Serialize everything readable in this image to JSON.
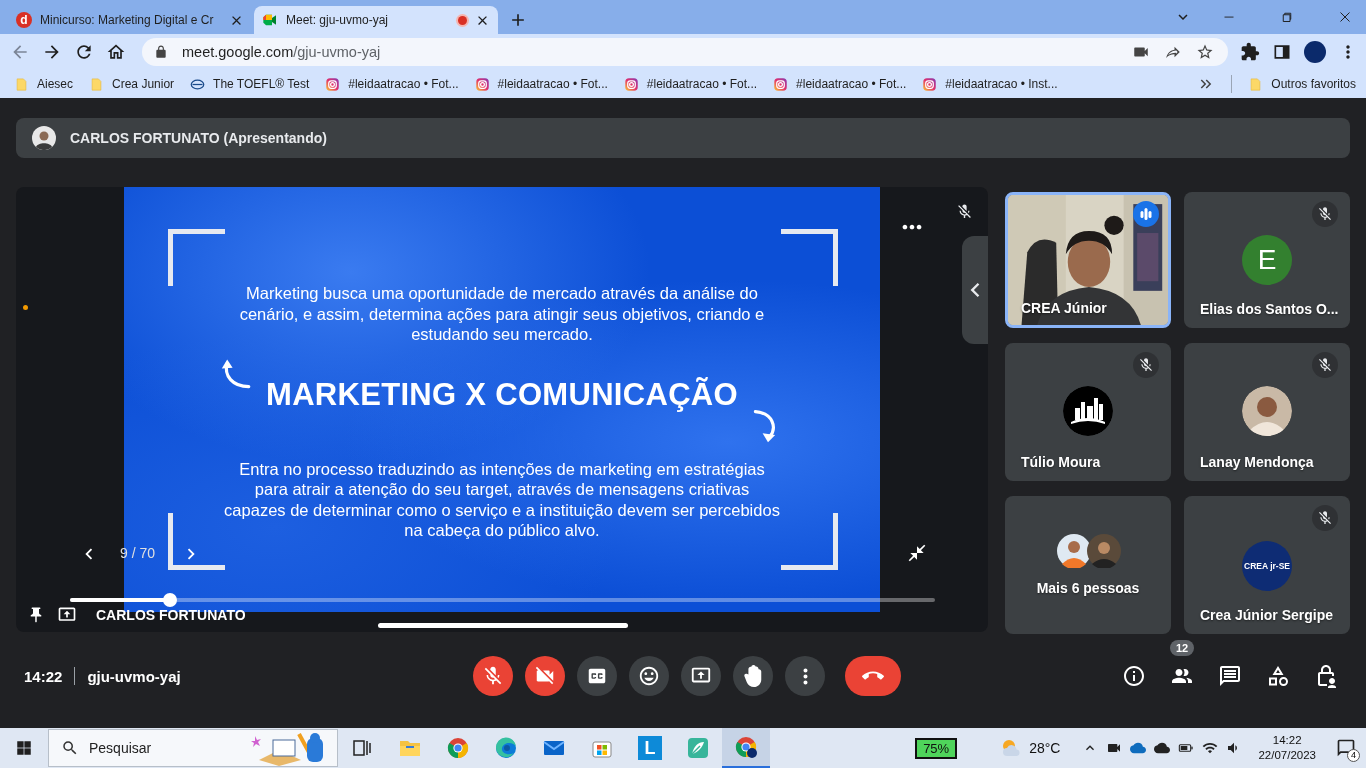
{
  "browser": {
    "tabs": [
      {
        "title": "Minicurso: Marketing Digital e Cr",
        "favicon_letter": "d",
        "recording": false,
        "selected": false
      },
      {
        "title": "Meet: gju-uvmo-yaj",
        "recording": true,
        "selected": true
      }
    ],
    "address": {
      "host": "meet.google.com",
      "path": "/gju-uvmo-yaj"
    },
    "bookmarks": [
      {
        "kind": "folder",
        "label": "Aiesec"
      },
      {
        "kind": "folder",
        "label": "Crea Junior"
      },
      {
        "kind": "ets",
        "label": "The TOEFL® Test"
      },
      {
        "kind": "instagram",
        "label": "#leidaatracao • Fot..."
      },
      {
        "kind": "instagram",
        "label": "#leidaatracao • Fot..."
      },
      {
        "kind": "instagram",
        "label": "#leidaatracao • Fot..."
      },
      {
        "kind": "instagram",
        "label": "#leidaatracao • Fot..."
      },
      {
        "kind": "instagram",
        "label": "#leidaatracao • Inst..."
      }
    ],
    "other_bookmarks": "Outros favoritos"
  },
  "meet": {
    "presenter_bar": "CARLOS FORTUNATO (Apresentando)",
    "slide": {
      "paragraph_1": "Marketing busca uma oportunidade de mercado através da análise do cenário, e assim, determina ações para atingir seus objetivos, criando e estudando seu mercado.",
      "title": "MARKETING X COMUNICAÇÃO",
      "paragraph_2": "Entra no processo traduzindo as intenções de marketing em estratégias para atrair a atenção do seu target, através de mensagens criativas capazes de determinar como o serviço e a instituição devem ser percebidos na cabeça do público alvo."
    },
    "slide_counter": "9 / 70",
    "progress": {
      "level": 0.116
    },
    "presenter_name": "CARLOS FORTUNATO",
    "presenter_muted": true,
    "tiles": [
      {
        "kind": "video",
        "name": "CREA Júnior",
        "speaking": true,
        "muted": false
      },
      {
        "kind": "letter",
        "name": "Elias dos Santos O...",
        "letter": "E",
        "speaking": false,
        "muted": true
      },
      {
        "name": "Túlio Moura",
        "speaking": false,
        "muted": true
      },
      {
        "name": "Lanay Mendonça",
        "speaking": false,
        "muted": true
      },
      {
        "kind": "group",
        "name": "Mais 6 pessoas",
        "speaking": false,
        "muted": false
      },
      {
        "kind": "logo",
        "name": "Crea Júnior Sergipe",
        "logo_text": "CREA jr-SE",
        "speaking": false,
        "muted": true
      }
    ],
    "time": "14:22",
    "meeting_code": "gju-uvmo-yaj",
    "controls": [
      {
        "kind": "mic",
        "off": true
      },
      {
        "kind": "camera",
        "off": true
      },
      {
        "kind": "captions",
        "off": false
      },
      {
        "kind": "emoji",
        "off": false
      },
      {
        "kind": "present",
        "off": false
      },
      {
        "kind": "hand",
        "off": false
      },
      {
        "kind": "more",
        "off": false
      },
      {
        "kind": "hangup"
      }
    ],
    "side_actions": [
      {
        "kind": "info"
      },
      {
        "kind": "people",
        "badge": "12"
      },
      {
        "kind": "chat"
      },
      {
        "kind": "activities"
      },
      {
        "kind": "host"
      }
    ]
  },
  "taskbar": {
    "search_placeholder": "Pesquisar",
    "apps": [
      {
        "kind": "taskview",
        "selected": false
      },
      {
        "kind": "explorer",
        "selected": false
      },
      {
        "kind": "chrome",
        "selected": false
      },
      {
        "kind": "edge",
        "selected": false
      },
      {
        "kind": "mail",
        "selected": false
      },
      {
        "kind": "store",
        "selected": false
      },
      {
        "kind": "letter",
        "letter": "L",
        "selected": false
      },
      {
        "kind": "feather",
        "selected": false
      },
      {
        "kind": "chrome-profile",
        "selected": true
      }
    ],
    "battery_widget": "75%",
    "weather": "28°C",
    "time": "14:22",
    "date": "22/07/2023",
    "notifications": "4"
  }
}
